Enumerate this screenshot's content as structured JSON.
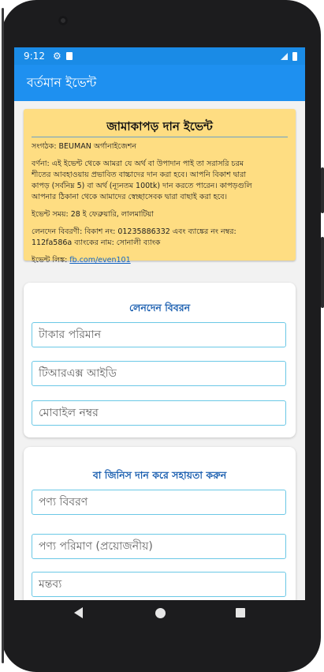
{
  "status_bar": {
    "time": "9:12"
  },
  "app_bar": {
    "title": "বর্তমান ইভেন্ট"
  },
  "event": {
    "title": "জামাকাপড় দান ইভেন্ট",
    "organizer": "সংগঠক: BEUMAN অর্গানাইজেশন",
    "description_1": "বর্ণনা: এই ইভেন্ট থেকে আমরা যে অর্থ বা উপাদান পাই তা সরাসরি চরম",
    "description_2": "শীতের আবহাওয়ায় প্রভাবিত বাচ্চাদের দান করা হবে। আপনি বিকাশ দ্বারা",
    "description_3": "কাপড় (সর্বনিম্ন 5) বা অর্থ (ন্যূনতম 100tk) দান করতে পারেন। কাপড়গুলি",
    "description_4": "আপনার ঠিকানা থেকে আমাদের স্বেচ্ছাসেবক দ্বারা বাছাই করা হবে।",
    "time": "ইভেন্ট সময়: 28 ই ফেব্রুয়ারি, লালমাটিয়া",
    "transaction_1": "লেনদেন বিবরণী: বিকাশ নং: 01235886332 এবং ব্যাঙ্কের নং নম্বর:",
    "transaction_2": "112fa586a ব্যাংকের নাম: সোনালী ব্যাংক",
    "link_label": "ইভেন্ট লিঙ্ক: ",
    "link_url": "fb.com/even101"
  },
  "transaction_form": {
    "heading": "লেনদেন বিবরন",
    "amount_placeholder": "টাকার পরিমান",
    "trxid_placeholder": "টিআরএক্স আইডি",
    "mobile_placeholder": "মোবাইল নম্বর"
  },
  "goods_form": {
    "heading": "বা জিনিস দান করে সহায়তা করুন",
    "product_desc_placeholder": "পণ্য বিবরণ",
    "product_qty_placeholder": "পণ্য পরিমাণ (প্রয়োজনীয়)",
    "comment_placeholder": "মন্তব্য"
  }
}
